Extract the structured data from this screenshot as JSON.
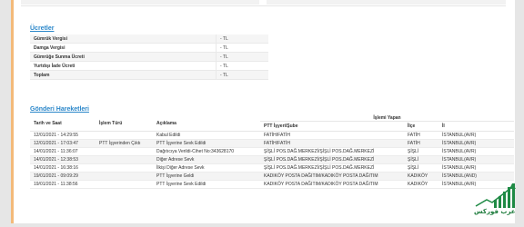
{
  "fees": {
    "title": "Ücretler",
    "rows": [
      {
        "label": "Gümrük Vergisi",
        "value": "- TL"
      },
      {
        "label": "Damga Vergisi",
        "value": "- TL"
      },
      {
        "label": "Gümrüğe Sunma Ücreti",
        "value": "- TL"
      },
      {
        "label": "Yurtdışı İade Ücreti",
        "value": "- TL"
      },
      {
        "label": "Toplam",
        "value": "- TL"
      }
    ]
  },
  "movements": {
    "title": "Gönderi Hareketleri",
    "headers": {
      "date": "Tarih ve Saat",
      "op_type": "İşlem Türü",
      "desc": "Açıklama",
      "performed": "İşlemi Yapan",
      "office": "PTT İşyeri/Şube",
      "district": "İlçe",
      "city": "İl"
    },
    "rows": [
      {
        "date": "12/01/2021 - 14:29:55",
        "op": "",
        "desc": "Kabul Edildi",
        "office": "FATİH/FATİH",
        "district": "FATİH",
        "city": "İSTANBUL(AVR)"
      },
      {
        "date": "12/01/2021 - 17:03:47",
        "op": "PTT İşyerinden Çıktı",
        "desc": "PTT İşyerine Sevk Edildi",
        "office": "FATİH/FATİH",
        "district": "FATİH",
        "city": "İSTANBUL(AVR)"
      },
      {
        "date": "14/01/2021 - 11:36:07",
        "op": "",
        "desc": "Dağıtıcıya Verildi-Cihet No:343628170",
        "office": "ŞİŞLİ POS.DAĞ.MERKEZİ/ŞİŞLİ POS.DAĞ.MERKEZİ",
        "district": "ŞİŞLİ",
        "city": "İSTANBUL(AVR)"
      },
      {
        "date": "14/01/2021 - 12:38:53",
        "op": "",
        "desc": "Diğer Adrese Sevk",
        "office": "ŞİŞLİ POS.DAĞ.MERKEZİ/ŞİŞLİ POS.DAĞ.MERKEZİ",
        "district": "ŞİŞLİ",
        "city": "İSTANBUL(AVR)"
      },
      {
        "date": "14/01/2021 - 16:38:16",
        "op": "",
        "desc": "İlkişi Diğer Adrese Sevk",
        "office": "ŞİŞLİ POS.DAĞ.MERKEZİ/ŞİŞLİ POS.DAĞ.MERKEZİ",
        "district": "ŞİŞLİ",
        "city": "İSTANBUL(AVR)"
      },
      {
        "date": "19/01/2021 - 09:09:29",
        "op": "",
        "desc": "PTT İşyerine Geldi",
        "office": "KADIKÖY POSTA DAĞITIM/KADIKÖY POSTA DAĞITIM",
        "district": "KADIKÖY",
        "city": "İSTANBUL(AND)"
      },
      {
        "date": "19/01/2021 - 11:38:56",
        "op": "",
        "desc": "PTT İşyerine Sevk Edildi",
        "office": "KADIKÖY POSTA DAĞITIM/KADIKÖY POSTA DAĞITIM",
        "district": "KADIKÖY",
        "city": "İSTANBUL(AVR)"
      }
    ]
  },
  "watermark": {
    "text": "عرب فوركس",
    "icon": "forex-chart-logo",
    "color": "#1b7a3a"
  },
  "colors": {
    "accent": "#2a86c9",
    "sidebar_border": "#f3ba7a"
  }
}
